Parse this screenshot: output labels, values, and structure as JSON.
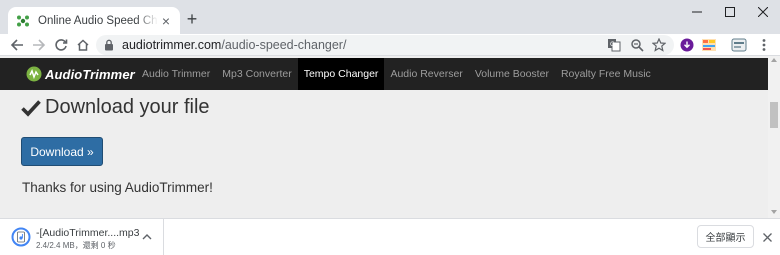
{
  "browser": {
    "tab": {
      "title": "Online Audio Speed Changer -",
      "favicon": "audiotrimmer-favicon",
      "close_glyph": "×"
    },
    "new_tab_glyph": "+",
    "window_controls": {
      "minimize": "minimize-icon",
      "maximize": "maximize-icon",
      "close": "close-icon"
    },
    "url": {
      "host": "audiotrimmer.com",
      "path": "/audio-speed-changer/"
    },
    "toolbar_icons": [
      "back-icon",
      "forward-icon",
      "reload-icon",
      "home-icon",
      "lock-icon",
      "translate-icon",
      "zoom-icon",
      "star-icon",
      "profile-download-icon",
      "extension-icon",
      "extension-icon",
      "menu-icon"
    ]
  },
  "site": {
    "logo_text": "AudioTrimmer",
    "nav": [
      {
        "label": "Audio Trimmer",
        "active": false
      },
      {
        "label": "Mp3 Converter",
        "active": false
      },
      {
        "label": "Tempo Changer",
        "active": true
      },
      {
        "label": "Audio Reverser",
        "active": false
      },
      {
        "label": "Volume Booster",
        "active": false
      },
      {
        "label": "Royalty Free Music",
        "active": false
      }
    ],
    "heading": "Download your file",
    "download_button": "Download »",
    "thanks": "Thanks for using AudioTrimmer!"
  },
  "download_shelf": {
    "file_name": "-[AudioTrimmer....mp3",
    "status": "2.4/2.4 MB，還剩 0 秒",
    "show_all": "全部顯示",
    "close_glyph": "×"
  },
  "colors": {
    "accent_blue": "#2e6da4",
    "site_nav_bg": "#222222",
    "active_nav_bg": "#000000",
    "logo_green": "#7cb342"
  }
}
